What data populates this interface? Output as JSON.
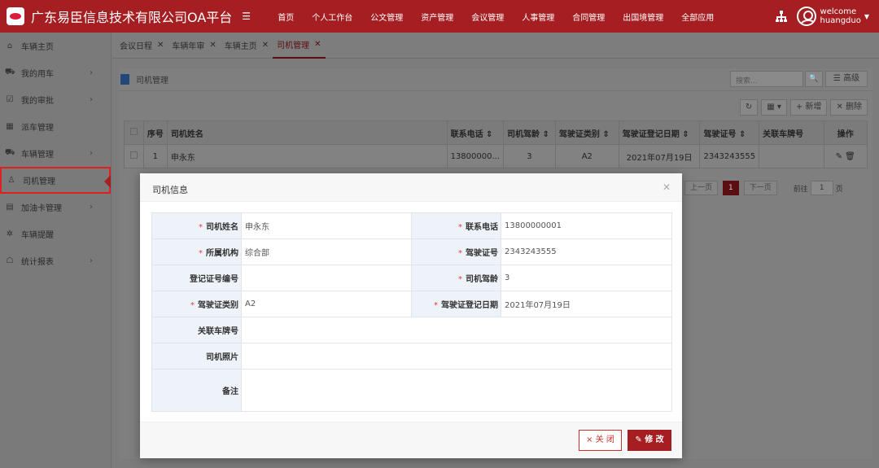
{
  "header": {
    "brand": "广东易臣信息技术有限公司OA平台",
    "menu_toggle": "☰",
    "nav": [
      "首页",
      "个人工作台",
      "公文管理",
      "资产管理",
      "会议管理",
      "人事管理",
      "合同管理",
      "出国境管理",
      "全部应用"
    ],
    "welcome": "welcome",
    "username": "huangduo",
    "caret": "▼"
  },
  "sidebar": {
    "items": [
      {
        "label": "车辆主页",
        "icon": "⌂",
        "arrow": ""
      },
      {
        "label": "我的用车",
        "icon": "⛟",
        "arrow": "›"
      },
      {
        "label": "我的审批",
        "icon": "☑",
        "arrow": "›"
      },
      {
        "label": "派车管理",
        "icon": "▦",
        "arrow": ""
      },
      {
        "label": "车辆管理",
        "icon": "⛟",
        "arrow": "›"
      },
      {
        "label": "司机管理",
        "icon": "♙",
        "arrow": ""
      },
      {
        "label": "加油卡管理",
        "icon": "▤",
        "arrow": "›"
      },
      {
        "label": "车辆提醒",
        "icon": "✲",
        "arrow": ""
      },
      {
        "label": "统计报表",
        "icon": "☖",
        "arrow": "›"
      }
    ]
  },
  "tabs": [
    {
      "label": "会议日程"
    },
    {
      "label": "车辆年审"
    },
    {
      "label": "车辆主页"
    },
    {
      "label": "司机管理"
    }
  ],
  "tab_close": "✕",
  "panel": {
    "title": "司机管理",
    "search_placeholder": "搜索...",
    "search_icon": "🔍",
    "advanced": "☰ 高级",
    "refresh": "↻",
    "columns_btn": "▦ ▾",
    "add": "+ 新增",
    "delete": "✕ 删除"
  },
  "table": {
    "headers": [
      "序号",
      "司机姓名",
      "联系电话 ⇕",
      "司机驾龄 ⇕",
      "驾驶证类别 ⇕",
      "驾驶证登记日期 ⇕",
      "驾驶证号 ⇕",
      "关联车牌号",
      "操作"
    ],
    "rows": [
      [
        "1",
        "申永东",
        "13800000...",
        "3",
        "A2",
        "2021年07月19日",
        "2343243555",
        "",
        "✎ 🗑"
      ]
    ]
  },
  "pager": {
    "prev": "上一页",
    "current": "1",
    "next": "下一页",
    "goto_prefix": "前往",
    "goto_value": "1",
    "goto_suffix": "页"
  },
  "modal": {
    "title": "司机信息",
    "close_icon": "✕",
    "fields": {
      "driver_name_label": "司机姓名",
      "driver_name": "申永东",
      "phone_label": "联系电话",
      "phone": "13800000001",
      "org_label": "所属机构",
      "org": "综合部",
      "license_no_label": "驾驶证号",
      "license_no": "2343243555",
      "reg_no_label": "登记证号编号",
      "reg_no": "",
      "driving_age_label": "司机驾龄",
      "driving_age": "3",
      "license_type_label": "驾驶证类别",
      "license_type": "A2",
      "license_date_label": "驾驶证登记日期",
      "license_date": "2021年07月19日",
      "plate_label": "关联车牌号",
      "plate": "",
      "photo_label": "司机照片",
      "photo": "",
      "remark_label": "备注",
      "remark": ""
    },
    "required_mark": "*",
    "close_btn": "× 关 闭",
    "edit_btn": "✎ 修 改"
  },
  "colors": {
    "brand": "#a51e22",
    "required": "#e23b3b",
    "label_bg": "#eef2f9"
  }
}
